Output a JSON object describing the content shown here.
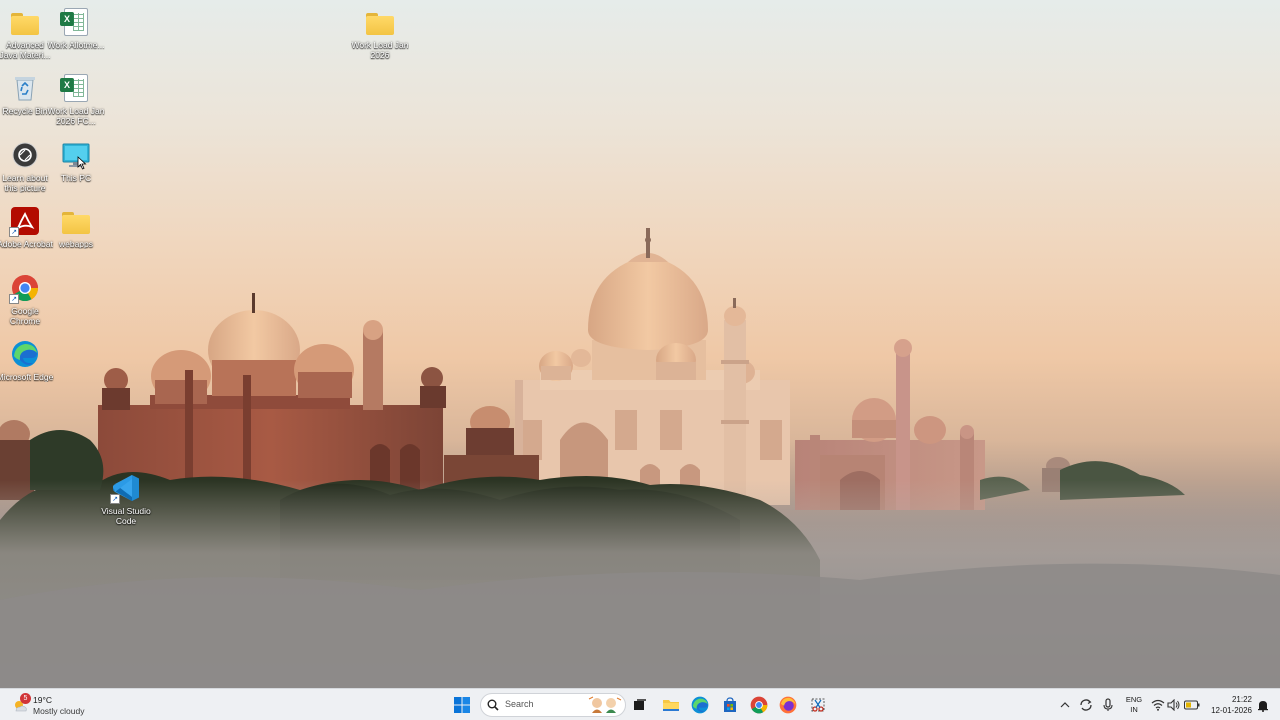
{
  "desktop": {
    "icons": [
      {
        "label": "Advanced Java Materi...",
        "icon": "folder-icon"
      },
      {
        "label": "Work Allotme...",
        "icon": "excel-file-icon"
      },
      {
        "label": "Work Load Jan 2026",
        "icon": "folder-icon"
      },
      {
        "label": "Recycle Bin",
        "icon": "recycle-bin-icon"
      },
      {
        "label": "Work Load Jan 2026 FC...",
        "icon": "excel-file-icon"
      },
      {
        "label": "Learn about this picture",
        "icon": "camera-icon"
      },
      {
        "label": "This PC",
        "icon": "monitor-icon"
      },
      {
        "label": "Adobe Acrobat",
        "icon": "acrobat-icon"
      },
      {
        "label": "webapps",
        "icon": "folder-icon"
      },
      {
        "label": "Google Chrome",
        "icon": "chrome-icon"
      },
      {
        "label": "Microsoft Edge",
        "icon": "edge-icon"
      },
      {
        "label": "Visual Studio Code",
        "icon": "vscode-icon"
      }
    ]
  },
  "taskbar": {
    "weather": {
      "temp": "19°C",
      "condition": "Mostly cloudy",
      "alert_count": "5"
    },
    "search": {
      "placeholder": "Search"
    },
    "pinned": [
      {
        "name": "start-button",
        "icon": "windows-logo-icon"
      },
      {
        "name": "task-view",
        "icon": "task-view-icon"
      },
      {
        "name": "file-explorer",
        "icon": "folder-icon"
      },
      {
        "name": "edge",
        "icon": "edge-icon"
      },
      {
        "name": "microsoft-store",
        "icon": "store-icon"
      },
      {
        "name": "chrome",
        "icon": "chrome-icon"
      },
      {
        "name": "firefox",
        "icon": "firefox-icon"
      },
      {
        "name": "snipping-tool",
        "icon": "snipping-tool-icon"
      }
    ],
    "tray": {
      "lang_line1": "ENG",
      "lang_line2": "IN",
      "time": "21:22",
      "date": "12-01-2026"
    }
  },
  "colors": {
    "taskbar_bg": "#eef0f3",
    "accent_blue": "#0078d4",
    "folder_yellow": "#ffd968"
  }
}
